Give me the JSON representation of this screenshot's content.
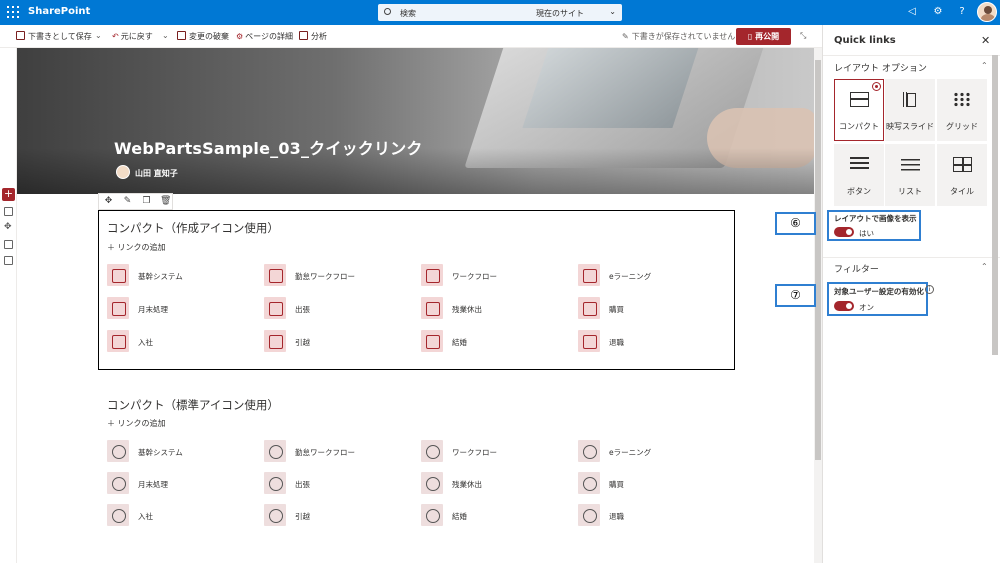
{
  "topbar": {
    "brand": "SharePoint",
    "search_placeholder": "検索",
    "search_scope": "現在のサイト",
    "icons": [
      "megaphone-icon",
      "gear-icon",
      "help-icon"
    ]
  },
  "cmdbar": {
    "save_draft": "下書きとして保存",
    "undo": "元に戻す",
    "discard": "変更の破棄",
    "page_details": "ページの詳細",
    "analytics": "分析",
    "draft_status": "下書きが保存されていません",
    "republish": "再公開"
  },
  "hero": {
    "title": "WebPartsSample_03_クイックリンク",
    "author": "山田 直知子"
  },
  "section1": {
    "title": "コンパクト（作成アイコン使用）",
    "add_link": "＋ リンクの追加",
    "items": [
      [
        "基幹システム",
        "勤怠ワークフロー",
        "ワークフロー",
        "eラーニング"
      ],
      [
        "月末処理",
        "出張",
        "残業休出",
        "購買"
      ],
      [
        "入社",
        "引越",
        "結婚",
        "退職"
      ]
    ]
  },
  "section2": {
    "title": "コンパクト（標準アイコン使用）",
    "add_link": "＋ リンクの追加",
    "items": [
      [
        "基幹システム",
        "勤怠ワークフロー",
        "ワークフロー",
        "eラーニング"
      ],
      [
        "月末処理",
        "出張",
        "残業休出",
        "購買"
      ],
      [
        "入社",
        "引越",
        "結婚",
        "退職"
      ]
    ]
  },
  "panel": {
    "title": "Quick links",
    "layout_heading": "レイアウト オプション",
    "layouts": [
      "コンパクト",
      "映写スライド",
      "グリッド",
      "ボタン",
      "リスト",
      "タイル"
    ],
    "selected_layout": "コンパクト",
    "show_image_label": "レイアウトで画像を表示",
    "show_image_value": "はい",
    "filter_heading": "フィルター",
    "audience_label": "対象ユーザー設定の有効化",
    "audience_value": "オン"
  },
  "callouts": {
    "six": "⑥",
    "seven": "⑦"
  },
  "colors": {
    "suite_bar": "#0078d4",
    "accent": "#a4262c",
    "callout": "#2f7fd1"
  }
}
